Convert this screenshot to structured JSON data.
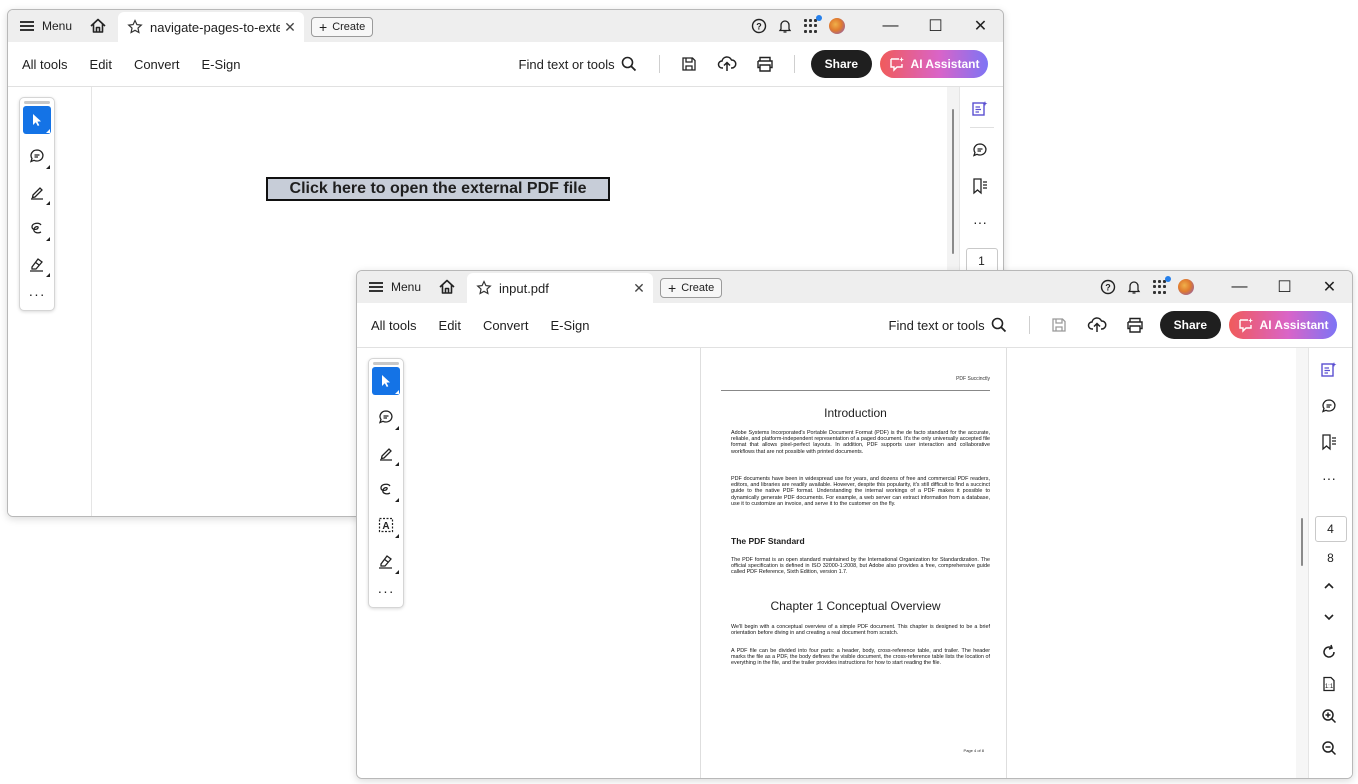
{
  "window1": {
    "menu_label": "Menu",
    "tab_title": "navigate-pages-to-exter...",
    "create_label": "Create",
    "menus": [
      "All tools",
      "Edit",
      "Convert",
      "E-Sign"
    ],
    "find_label": "Find text or tools",
    "share_label": "Share",
    "ai_label": "AI Assistant",
    "link_text": "Click here to open the external PDF file",
    "page_number": "1"
  },
  "window2": {
    "menu_label": "Menu",
    "tab_title": "input.pdf",
    "create_label": "Create",
    "menus": [
      "All tools",
      "Edit",
      "Convert",
      "E-Sign"
    ],
    "find_label": "Find text or tools",
    "share_label": "Share",
    "ai_label": "AI Assistant",
    "current_page": "4",
    "total_pages": "8",
    "pdf": {
      "running_header": "PDF Succinctly",
      "heading_intro": "Introduction",
      "para1": "Adobe Systems Incorporated's Portable Document Format (PDF) is the de facto standard for the accurate, reliable, and platform-independent representation of a paged document. It's the only universally accepted file format that allows pixel-perfect layouts. In addition, PDF supports user interaction and collaborative workflows that are not possible with printed documents.",
      "para2": "PDF documents have been in widespread use for years, and dozens of free and commercial PDF readers, editors, and libraries are readily available. However, despite this popularity, it's still difficult to find a succinct guide to the native PDF format. Understanding the internal workings of a PDF makes it possible to dynamically generate PDF documents. For example, a web server can extract information from a database, use it to customize an invoice, and serve it to the customer on the fly.",
      "heading_standard": "The PDF Standard",
      "para3": "The PDF format is an open standard maintained by the International Organization for Standardization. The official specification is defined in ISO 32000-1:2008, but Adobe also provides a free, comprehensive guide called PDF Reference, Sixth Edition, version 1.7.",
      "heading_chapter": "Chapter 1 Conceptual Overview",
      "para4": "We'll begin with a conceptual overview of a simple PDF document. This chapter is designed to be a brief orientation before diving in and creating a real document from scratch.",
      "para5": "A PDF file can be divided into four parts: a header, body, cross-reference table, and trailer. The header marks the file as a PDF, the body defines the visible document, the cross-reference table lists the location of everything in the file, and the trailer provides instructions for how to start reading the file.",
      "footer": "Page 4 of 8"
    }
  }
}
